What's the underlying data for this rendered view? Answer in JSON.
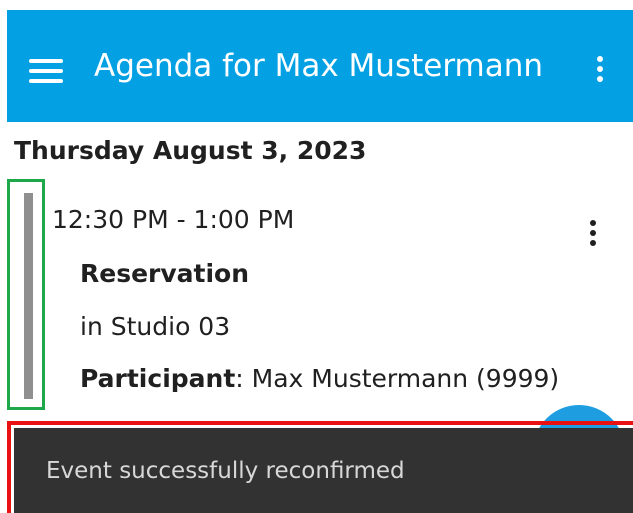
{
  "app_bar": {
    "title": "Agenda for Max Mustermann",
    "menu_icon": "hamburger-menu-icon",
    "overflow_icon": "more-vert-icon",
    "color": "#03a0e3"
  },
  "agenda": {
    "date": "Thursday August 3, 2023",
    "event": {
      "time": "12:30 PM - 1:00 PM",
      "title": "Reservation",
      "location": "in Studio 03",
      "participant_label": "Participant",
      "participant_value": ": Max Mustermann (9999)",
      "indicator_color": "#8f8f8f",
      "overflow_icon": "more-vert-icon"
    }
  },
  "snackbar": {
    "message": "Event successfully reconfirmed"
  },
  "annotations": {
    "green_box_color": "#1ea84a",
    "red_box_color": "#e81212"
  }
}
